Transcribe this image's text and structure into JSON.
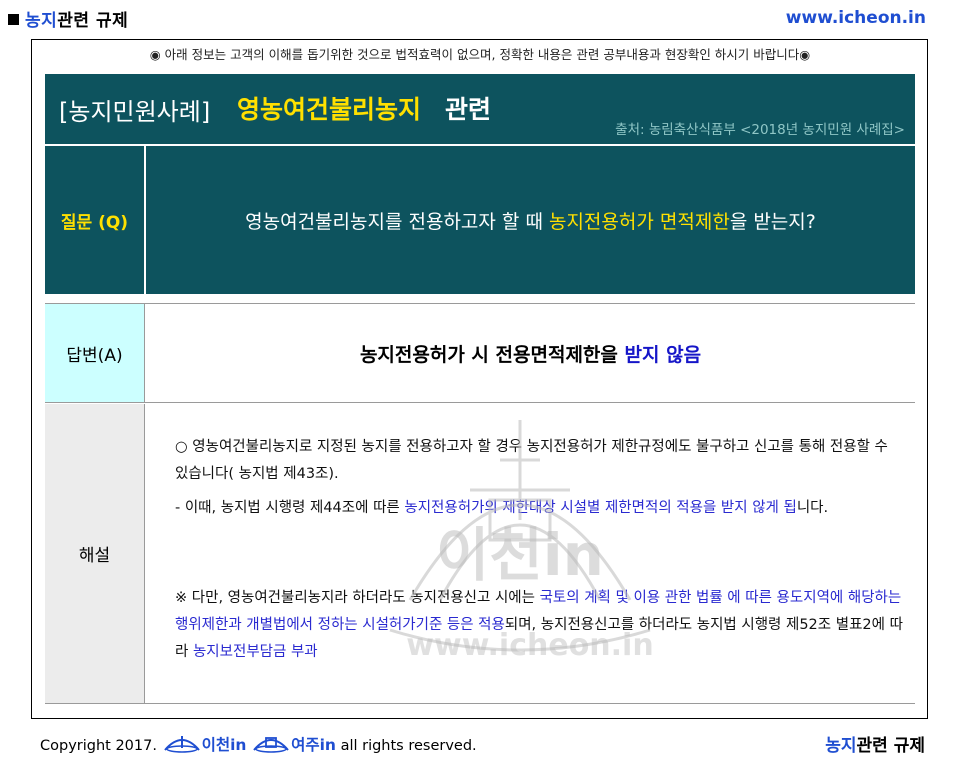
{
  "header": {
    "title_blue": "농지",
    "title_rest": "관련 규제",
    "url": "www.icheon.in"
  },
  "notice": "◉ 아래 정보는 고객의 이해를 돕기위한 것으로 법적효력이 없으며, 정확한 내용은 관련 공부내용과 현장확인 하시기 바랍니다◉",
  "banner": {
    "category": "[농지민원사례]",
    "topic": "영농여건불리농지",
    "suffix": "관련",
    "source": "출처: 농림축산식품부 <2018년 농지민원 사례집>"
  },
  "question": {
    "label": "질문 (Q)",
    "text_before": "영농여건불리농지를 전용하고자 할 때 ",
    "text_highlight": "농지전용허가 면적제한",
    "text_after": "을 받는지?"
  },
  "answer": {
    "label": "답변(A)",
    "text_before": "농지전용허가 시 전용면적제한을 ",
    "text_highlight": "받지 않음"
  },
  "explanation": {
    "label": "해설",
    "p1": "○ 영농여건불리농지로 지정된 농지를 전용하고자 할 경우 농지전용허가 제한규정에도 불구하고 신고를 통해 전용할 수 있습니다( 농지법  제43조).",
    "p2_before": "- 이때,  농지법 시행령  제44조에 따른 ",
    "p2_highlight": "농지전용허가의 제한대상 시설별 제한면적의 적용을 받지 않게 됩",
    "p2_after": "니다.",
    "p3_before": "※ 다만, 영농여건불리농지라 하더라도 농지전용신고 시에는  ",
    "p3_highlight1": "국토의 계획 및 이용 관한 법률 에 따른 용도지역에 해당하는 행위제한과 개별법에서 정하는 시설허가기준 등은 적용",
    "p3_middle": "되며, 농지전용신고를 하더라도 농지법 시행령 제52조 별표2에 따라 ",
    "p3_highlight2": "농지보전부담금 부과"
  },
  "watermark": {
    "text": "이천in",
    "url": "www.icheon.in"
  },
  "footer": {
    "copyright_prefix": "Copyright 2017.",
    "logo1_text": "이천in",
    "logo2_text": "여주in",
    "copyright_suffix": "all rights reserved.",
    "title_blue": "농지",
    "title_rest": "관련 규제"
  },
  "colors": {
    "banner_bg": "#0d535e",
    "highlight_yellow": "#ffe000",
    "answer_label_bg": "#ccffff",
    "explanation_label_bg": "#ececec",
    "link_blue": "#1f4ed1"
  }
}
